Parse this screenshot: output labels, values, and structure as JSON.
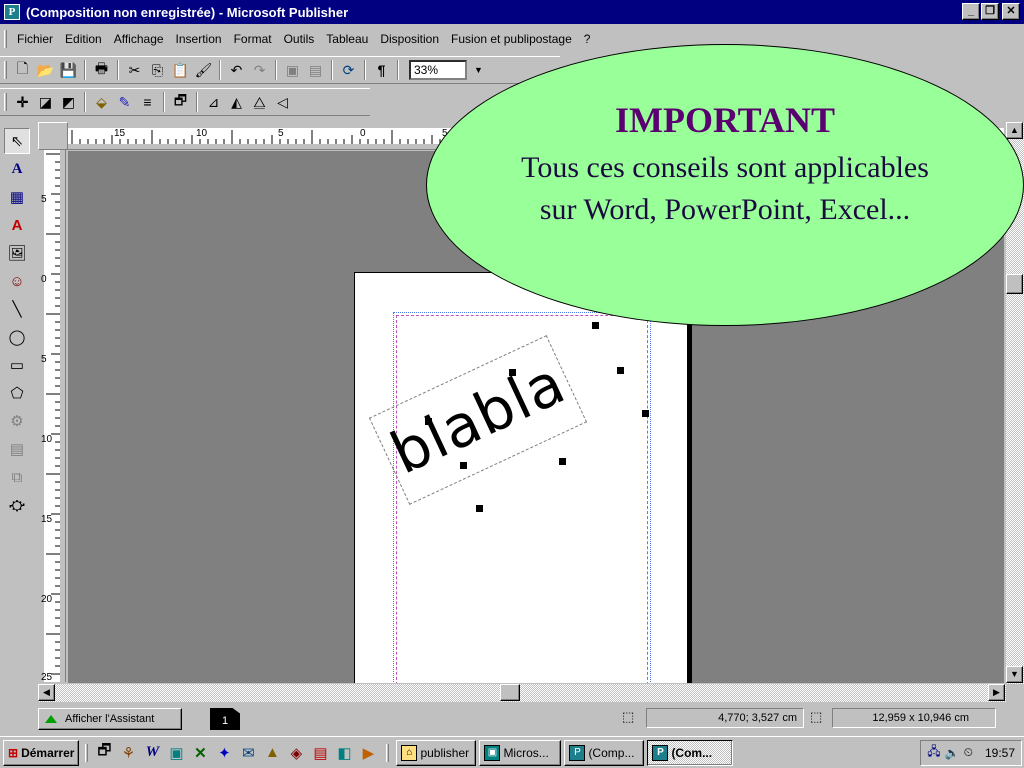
{
  "window": {
    "title": "(Composition non enregistrée) - Microsoft Publisher",
    "app_icon_label": "P",
    "buttons": {
      "minimize": "_",
      "maximize": "❐",
      "close": "✕"
    }
  },
  "menubar": {
    "items": [
      "Fichier",
      "Edition",
      "Affichage",
      "Insertion",
      "Format",
      "Outils",
      "Tableau",
      "Disposition",
      "Fusion et publipostage",
      "?"
    ]
  },
  "toolbar": {
    "zoom_value": "33%",
    "icons": [
      "new-icon",
      "open-icon",
      "save-icon",
      "print-icon",
      "cut-icon",
      "copy-icon",
      "paste-icon",
      "format-painter-icon",
      "undo-icon",
      "redo-icon",
      "bring-front-icon",
      "send-back-icon",
      "rotate-icon",
      "pilcrow-icon"
    ]
  },
  "format_toolbar": {
    "icons": [
      "move-icon",
      "shade-icon",
      "shadow-icon",
      "fill-color-icon",
      "line-color-icon",
      "line-style-icon",
      "properties-icon",
      "rotate-left-icon",
      "rotate-right-icon",
      "flip-horizontal-icon",
      "flip-vertical-icon"
    ]
  },
  "ruler": {
    "h_labels": [
      "15",
      "10",
      "5",
      "0",
      "5"
    ],
    "v_labels": [
      "5",
      "0",
      "5",
      "10",
      "15",
      "20",
      "25"
    ]
  },
  "document": {
    "textbox_text": "blabla"
  },
  "callout": {
    "title": "IMPORTANT",
    "line1": "Tous ces conseils sont applicables",
    "line2": "sur Word, PowerPoint, Excel..."
  },
  "statusbar": {
    "assistant_label": "Afficher l'Assistant",
    "page_number": "1",
    "position": "4,770; 3,527 cm",
    "size": "12,959 x  10,946 cm"
  },
  "taskbar": {
    "start_label": "Démarrer",
    "tasks": [
      {
        "label": "publisher",
        "active": false
      },
      {
        "label": "Micros...",
        "active": false
      },
      {
        "label": "(Comp...",
        "active": false
      },
      {
        "label": "(Com...",
        "active": true
      }
    ],
    "clock": "19:57"
  },
  "colors": {
    "titlebar": "#000080",
    "callout_fill": "#99ff99",
    "callout_title": "#5a0070",
    "workspace": "#808080"
  }
}
